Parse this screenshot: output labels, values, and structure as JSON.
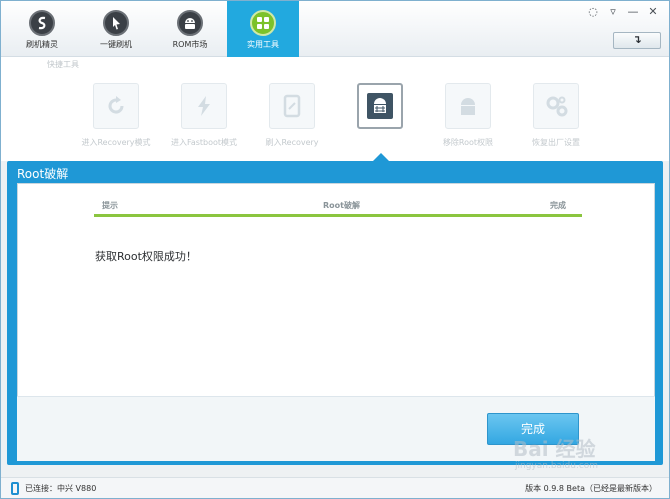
{
  "nav": {
    "tabs": [
      {
        "label": "刷机精灵",
        "icon": "logo-s-icon"
      },
      {
        "label": "一键刷机",
        "icon": "cursor-icon"
      },
      {
        "label": "ROM市场",
        "icon": "android-icon"
      },
      {
        "label": "实用工具",
        "icon": "grid-tools-icon",
        "active": true
      }
    ]
  },
  "window_controls": {
    "feedback": "◌",
    "menu": "▿",
    "minimize": "—",
    "close": "✕"
  },
  "refresh_label": "↴",
  "tools": {
    "section_label": "快捷工具",
    "items": [
      {
        "label": "进入Recovery模式",
        "icon": "refresh-icon"
      },
      {
        "label": "进入Fastboot模式",
        "icon": "lightning-icon"
      },
      {
        "label": "刷入Recovery",
        "icon": "tablet-icon"
      },
      {
        "label": "",
        "icon": "android-root-icon",
        "selected": true
      },
      {
        "label": "移除Root权限",
        "icon": "android-remove-icon"
      },
      {
        "label": "恢复出厂设置",
        "icon": "gears-icon"
      }
    ]
  },
  "dialog": {
    "title": "Root破解",
    "steps": [
      "提示",
      "Root破解",
      "完成"
    ],
    "progress": 1.0,
    "message": "获取Root权限成功！",
    "finish_label": "完成"
  },
  "watermark": {
    "text": "Bai 经验",
    "sub": "jingyan.baidu.com"
  },
  "status": {
    "connection": "已连接：中兴 V880",
    "version": "版本 0.9.8 Beta（已经是最新版本）"
  },
  "colors": {
    "accent": "#22a9df",
    "band": "#1f98d6",
    "progress": "#8bc53f",
    "active_icon": "#7cc22a"
  }
}
